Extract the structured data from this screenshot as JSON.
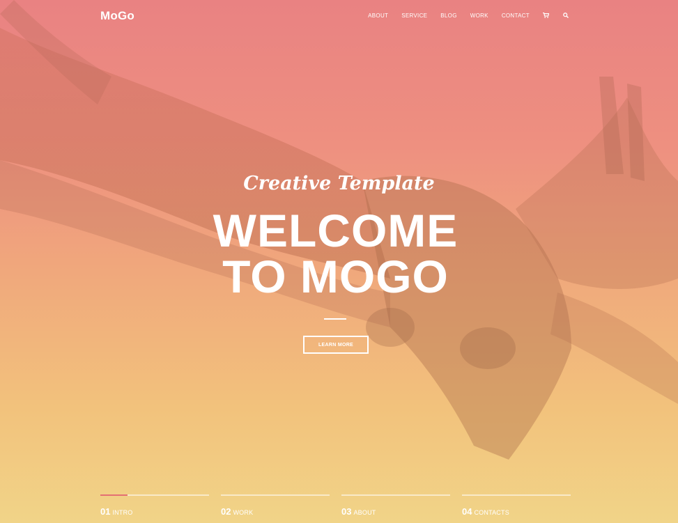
{
  "header": {
    "logo": "MoGo",
    "nav": [
      "ABOUT",
      "SERVICE",
      "BLOG",
      "WORK",
      "CONTACT"
    ],
    "icons": [
      "cart-icon",
      "search-icon"
    ]
  },
  "hero": {
    "subtitle": "Creative Template",
    "title_line1": "WELCOME",
    "title_line2": "TO MOGO",
    "button": "LEARN MORE",
    "background_colors": [
      "#e98282",
      "#f0a87c",
      "#f1d488"
    ]
  },
  "slides": [
    {
      "num": "01",
      "name": "INTRO",
      "active": true
    },
    {
      "num": "02",
      "name": "WORK",
      "active": false
    },
    {
      "num": "03",
      "name": "ABOUT",
      "active": false
    },
    {
      "num": "04",
      "name": "CONTACTS",
      "active": false
    }
  ],
  "accent": "#e46f73"
}
